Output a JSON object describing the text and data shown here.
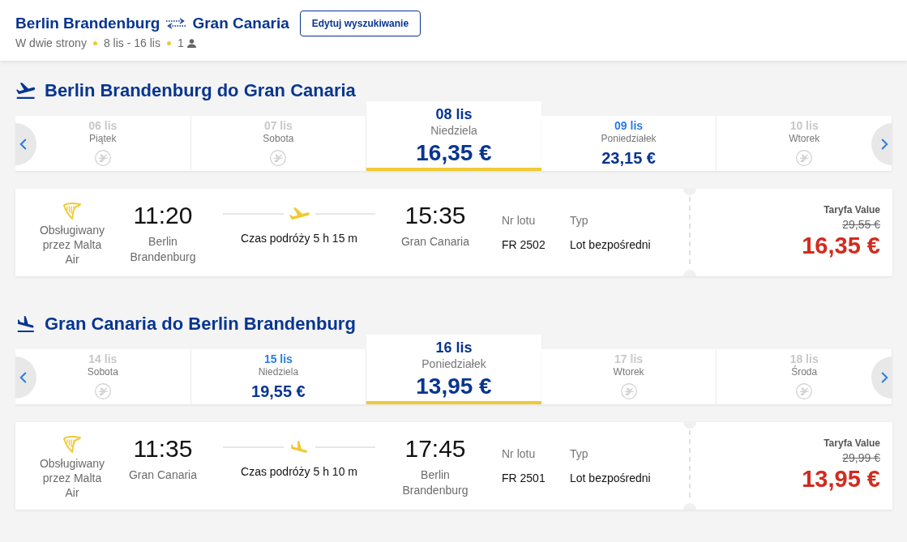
{
  "header": {
    "origin": "Berlin Brandenburg",
    "destination": "Gran Canaria",
    "edit_button": "Edytuj wyszukiwanie",
    "trip_type": "W dwie strony",
    "dates": "8 lis - 16 lis",
    "passengers": "1"
  },
  "journeys": [
    {
      "kind": "outbound",
      "title": "Berlin Brandenburg do Gran Canaria",
      "dates": [
        {
          "date": "06 lis",
          "day": "Piątek",
          "selected": false
        },
        {
          "date": "07 lis",
          "day": "Sobota",
          "selected": false
        },
        {
          "date": "08 lis",
          "day": "Niedziela",
          "price": "16,35 €",
          "selected": true
        },
        {
          "date": "09 lis",
          "day": "Poniedziałek",
          "price": "23,15 €",
          "selected": false
        },
        {
          "date": "10 lis",
          "day": "Wtorek",
          "selected": false
        }
      ],
      "flight": {
        "operator": "Obsługiwany przez Malta Air",
        "departure_time": "11:20",
        "departure_airport": "Berlin Brandenburg",
        "duration": "Czas podróży 5 h 15 m",
        "arrival_time": "15:35",
        "arrival_airport": "Gran Canaria",
        "flight_number_label": "Nr lotu",
        "flight_number": "FR 2502",
        "type_label": "Typ",
        "flight_type": "Lot bezpośredni",
        "fare_name": "Taryfa Value",
        "original_price": "29,55 €",
        "price": "16,35 €"
      }
    },
    {
      "kind": "return",
      "title": "Gran Canaria do Berlin Brandenburg",
      "dates": [
        {
          "date": "14 lis",
          "day": "Sobota",
          "selected": false
        },
        {
          "date": "15 lis",
          "day": "Niedziela",
          "price": "19,55 €",
          "selected": false
        },
        {
          "date": "16 lis",
          "day": "Poniedziałek",
          "price": "13,95 €",
          "selected": true
        },
        {
          "date": "17 lis",
          "day": "Wtorek",
          "selected": false
        },
        {
          "date": "18 lis",
          "day": "Środa",
          "selected": false
        }
      ],
      "flight": {
        "operator": "Obsługiwany przez Malta Air",
        "departure_time": "11:35",
        "departure_airport": "Gran Canaria",
        "duration": "Czas podróży 5 h 10 m",
        "arrival_time": "17:45",
        "arrival_airport": "Berlin Brandenburg",
        "flight_number_label": "Nr lotu",
        "flight_number": "FR 2501",
        "type_label": "Typ",
        "flight_type": "Lot bezpośredni",
        "fare_name": "Taryfa Value",
        "original_price": "29,99 €",
        "price": "13,95 €"
      }
    }
  ]
}
